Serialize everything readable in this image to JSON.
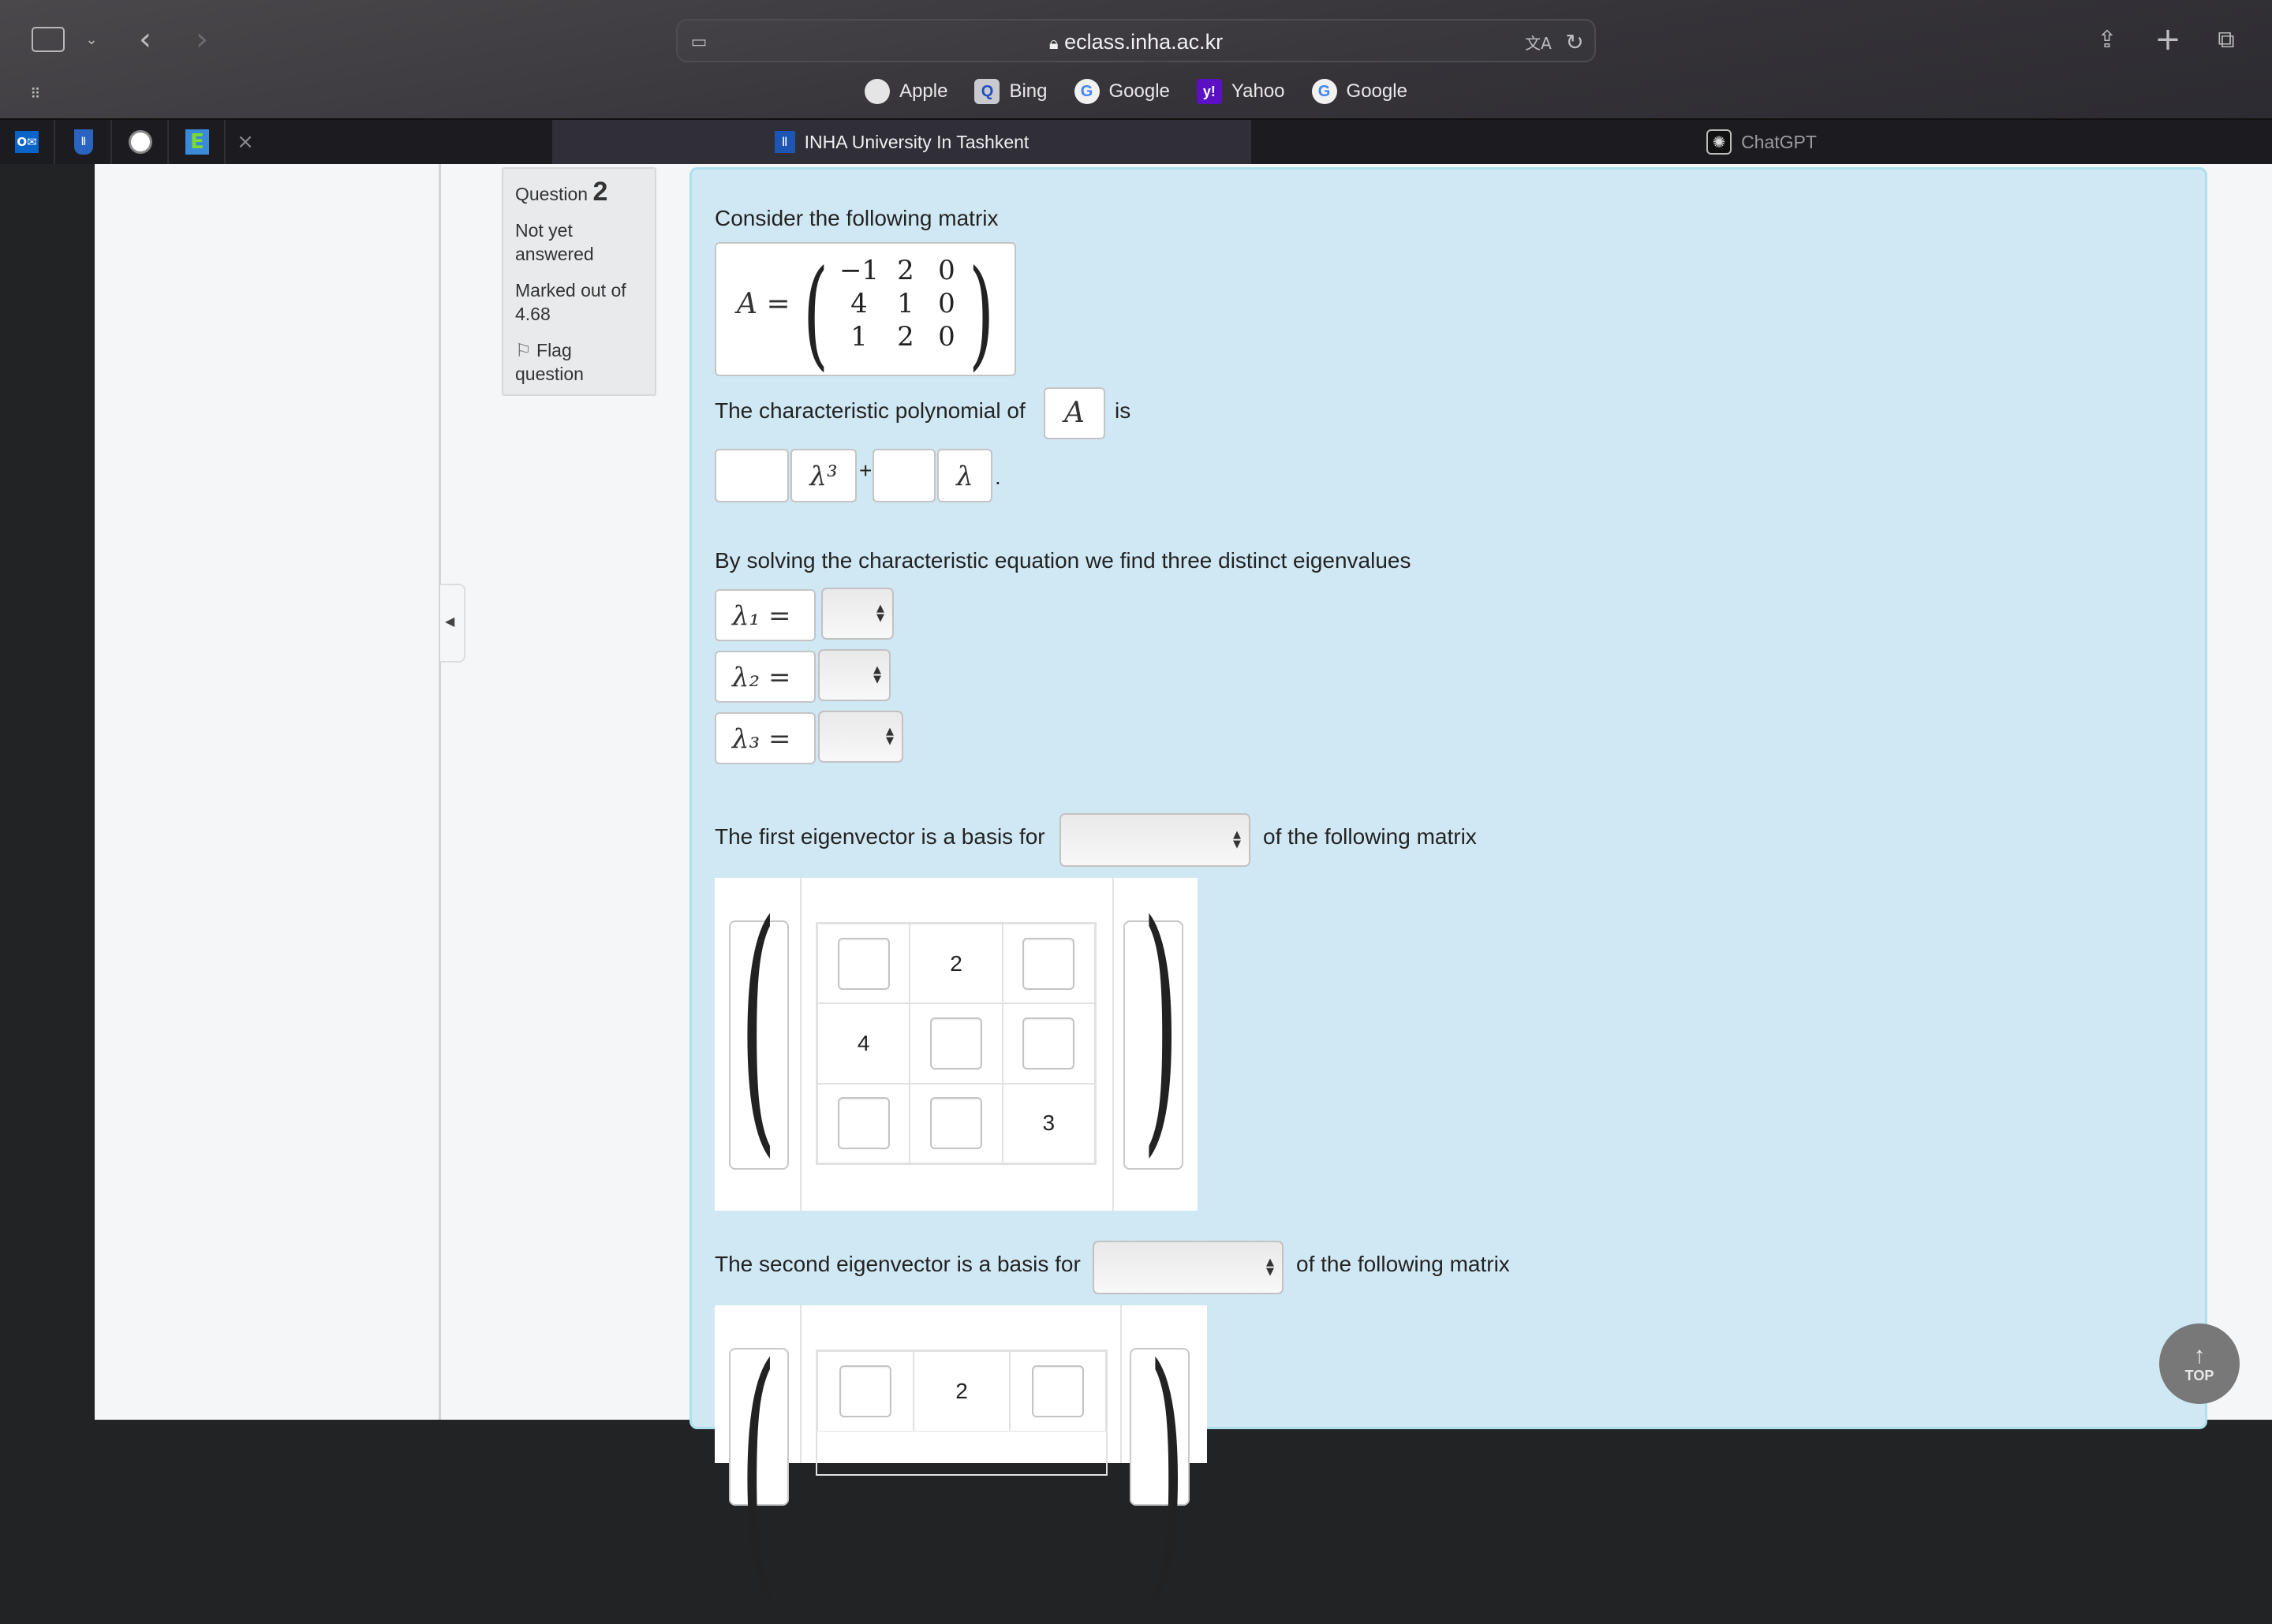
{
  "browser": {
    "url": "eclass.inha.ac.kr",
    "favorites": [
      {
        "label": "Apple",
        "icon": "apple-icon"
      },
      {
        "label": "Bing",
        "icon": "bing-icon"
      },
      {
        "label": "Google",
        "icon": "google-icon"
      },
      {
        "label": "Yahoo",
        "icon": "yahoo-icon"
      },
      {
        "label": "Google",
        "icon": "google-icon"
      }
    ],
    "tabs": [
      {
        "label": "INHA University In Tashkent",
        "active": true
      },
      {
        "label": "ChatGPT",
        "active": false
      }
    ],
    "pinned_close": "×"
  },
  "question_info": {
    "label": "Question",
    "number": "2",
    "status": "Not yet answered",
    "marked": "Marked out of 4.68",
    "flag": "Flag question"
  },
  "question": {
    "intro": "Consider the following matrix",
    "matrix_name": "A =",
    "matrix": [
      [
        "−1",
        "2",
        "0"
      ],
      [
        "4",
        "1",
        "0"
      ],
      [
        "1",
        "2",
        "0"
      ]
    ],
    "char_poly_text": "The characteristic polynomial of",
    "char_poly_var": "A",
    "char_poly_is": "is",
    "poly_term1": "λ³",
    "poly_plus": "+",
    "poly_term2": "λ",
    "poly_end": ".",
    "eigen_text": "By solving the characteristic equation we find  three distinct eigenvalues",
    "lambdas": [
      "λ₁ =",
      "λ₂ =",
      "λ₃ ="
    ],
    "first_eig_text": "The first eigenvector is a basis for",
    "first_eig_after": "of the following matrix",
    "first_matrix": [
      [
        "",
        "2",
        ""
      ],
      [
        "4",
        "",
        ""
      ],
      [
        "",
        "",
        "3"
      ]
    ],
    "second_eig_text": "The second eigenvector is a basis for",
    "second_eig_after": "of the following matrix",
    "second_matrix_row1": [
      "",
      "2",
      ""
    ]
  },
  "top_button": "TOP"
}
